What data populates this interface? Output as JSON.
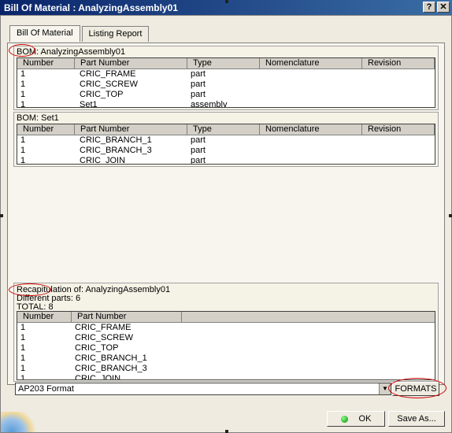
{
  "window": {
    "title": "Bill Of Material : AnalyzingAssembly01",
    "help_btn": "?",
    "close_btn": "✕"
  },
  "tabs": [
    {
      "label": "Bill Of Material"
    },
    {
      "label": "Listing Report"
    }
  ],
  "bom1": {
    "title": "BOM: AnalyzingAssembly01",
    "headers": [
      "Number",
      "Part Number",
      "Type",
      "Nomenclature",
      "Revision"
    ],
    "rows": [
      [
        "1",
        "CRIC_FRAME",
        "part",
        "",
        ""
      ],
      [
        "1",
        "CRIC_SCREW",
        "part",
        "",
        ""
      ],
      [
        "1",
        "CRIC_TOP",
        "part",
        "",
        ""
      ],
      [
        "1",
        "Set1",
        "assembly",
        "",
        ""
      ]
    ]
  },
  "bom2": {
    "title": "BOM: Set1",
    "headers": [
      "Number",
      "Part Number",
      "Type",
      "Nomenclature",
      "Revision"
    ],
    "rows": [
      [
        "1",
        "CRIC_BRANCH_1",
        "part",
        "",
        ""
      ],
      [
        "1",
        "CRIC_BRANCH_3",
        "part",
        "",
        ""
      ],
      [
        "1",
        "CRIC_JOIN",
        "part",
        "",
        ""
      ]
    ]
  },
  "recap": {
    "line1": "Recapitulation of: AnalyzingAssembly01",
    "line2": "Different parts: 6",
    "line3": "TOTAL: 8",
    "headers": [
      "Number",
      "Part Number"
    ],
    "rows": [
      [
        "1",
        "CRIC_FRAME"
      ],
      [
        "1",
        "CRIC_SCREW"
      ],
      [
        "1",
        "CRIC_TOP"
      ],
      [
        "1",
        "CRIC_BRANCH_1"
      ],
      [
        "1",
        "CRIC_BRANCH_3"
      ],
      [
        "1",
        "CRIC_JOIN"
      ]
    ]
  },
  "format": {
    "value": "AP203 Format",
    "formats_btn": "FORMATS"
  },
  "buttons": {
    "ok": "OK",
    "save_as": "Save As..."
  },
  "colors": {
    "annotation": "#cc0000",
    "titlebar": "#0a246a"
  }
}
